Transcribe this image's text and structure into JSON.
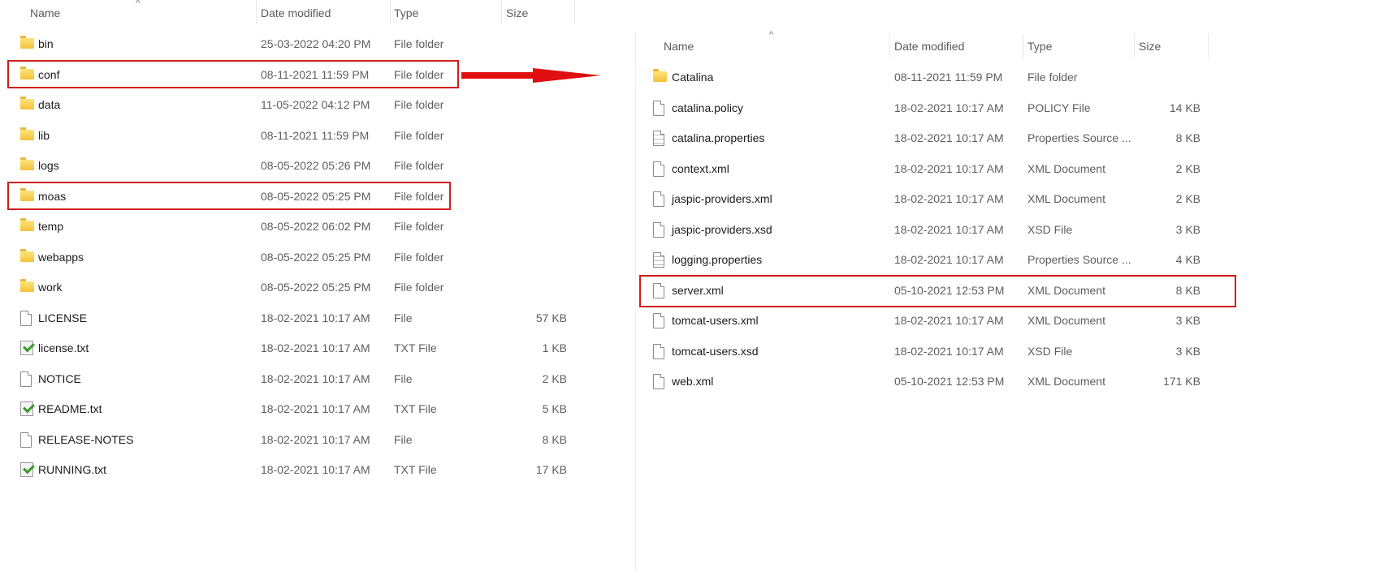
{
  "columns": {
    "name": "Name",
    "date": "Date modified",
    "type": "Type",
    "size": "Size"
  },
  "left_pane": {
    "items": [
      {
        "name": "bin",
        "date": "25-03-2022 04:20 PM",
        "type": "File folder",
        "size": "",
        "icon": "folder-icon"
      },
      {
        "name": "conf",
        "date": "08-11-2021 11:59 PM",
        "type": "File folder",
        "size": "",
        "icon": "folder-icon"
      },
      {
        "name": "data",
        "date": "11-05-2022 04:12 PM",
        "type": "File folder",
        "size": "",
        "icon": "folder-icon"
      },
      {
        "name": "lib",
        "date": "08-11-2021 11:59 PM",
        "type": "File folder",
        "size": "",
        "icon": "folder-icon"
      },
      {
        "name": "logs",
        "date": "08-05-2022 05:26 PM",
        "type": "File folder",
        "size": "",
        "icon": "folder-icon"
      },
      {
        "name": "moas",
        "date": "08-05-2022 05:25 PM",
        "type": "File folder",
        "size": "",
        "icon": "folder-icon"
      },
      {
        "name": "temp",
        "date": "08-05-2022 06:02 PM",
        "type": "File folder",
        "size": "",
        "icon": "folder-icon"
      },
      {
        "name": "webapps",
        "date": "08-05-2022 05:25 PM",
        "type": "File folder",
        "size": "",
        "icon": "folder-icon"
      },
      {
        "name": "work",
        "date": "08-05-2022 05:25 PM",
        "type": "File folder",
        "size": "",
        "icon": "folder-icon"
      },
      {
        "name": "LICENSE",
        "date": "18-02-2021 10:17 AM",
        "type": "File",
        "size": "57 KB",
        "icon": "file-icon"
      },
      {
        "name": "license.txt",
        "date": "18-02-2021 10:17 AM",
        "type": "TXT File",
        "size": "1 KB",
        "icon": "text-file-icon"
      },
      {
        "name": "NOTICE",
        "date": "18-02-2021 10:17 AM",
        "type": "File",
        "size": "2 KB",
        "icon": "file-icon"
      },
      {
        "name": "README.txt",
        "date": "18-02-2021 10:17 AM",
        "type": "TXT File",
        "size": "5 KB",
        "icon": "text-file-icon"
      },
      {
        "name": "RELEASE-NOTES",
        "date": "18-02-2021 10:17 AM",
        "type": "File",
        "size": "8 KB",
        "icon": "file-icon"
      },
      {
        "name": "RUNNING.txt",
        "date": "18-02-2021 10:17 AM",
        "type": "TXT File",
        "size": "17 KB",
        "icon": "text-file-icon"
      }
    ]
  },
  "right_pane": {
    "items": [
      {
        "name": "Catalina",
        "date": "08-11-2021 11:59 PM",
        "type": "File folder",
        "size": "",
        "icon": "folder-icon"
      },
      {
        "name": "catalina.policy",
        "date": "18-02-2021 10:17 AM",
        "type": "POLICY File",
        "size": "14 KB",
        "icon": "file-icon"
      },
      {
        "name": "catalina.properties",
        "date": "18-02-2021 10:17 AM",
        "type": "Properties Source ...",
        "size": "8 KB",
        "icon": "properties-file-icon"
      },
      {
        "name": "context.xml",
        "date": "18-02-2021 10:17 AM",
        "type": "XML Document",
        "size": "2 KB",
        "icon": "file-icon"
      },
      {
        "name": "jaspic-providers.xml",
        "date": "18-02-2021 10:17 AM",
        "type": "XML Document",
        "size": "2 KB",
        "icon": "file-icon"
      },
      {
        "name": "jaspic-providers.xsd",
        "date": "18-02-2021 10:17 AM",
        "type": "XSD File",
        "size": "3 KB",
        "icon": "file-icon"
      },
      {
        "name": "logging.properties",
        "date": "18-02-2021 10:17 AM",
        "type": "Properties Source ...",
        "size": "4 KB",
        "icon": "properties-file-icon"
      },
      {
        "name": "server.xml",
        "date": "05-10-2021 12:53 PM",
        "type": "XML Document",
        "size": "8 KB",
        "icon": "file-icon"
      },
      {
        "name": "tomcat-users.xml",
        "date": "18-02-2021 10:17 AM",
        "type": "XML Document",
        "size": "3 KB",
        "icon": "file-icon"
      },
      {
        "name": "tomcat-users.xsd",
        "date": "18-02-2021 10:17 AM",
        "type": "XSD File",
        "size": "3 KB",
        "icon": "file-icon"
      },
      {
        "name": "web.xml",
        "date": "05-10-2021 12:53 PM",
        "type": "XML Document",
        "size": "171 KB",
        "icon": "file-icon"
      }
    ]
  },
  "highlight_color": "#d21c1c"
}
